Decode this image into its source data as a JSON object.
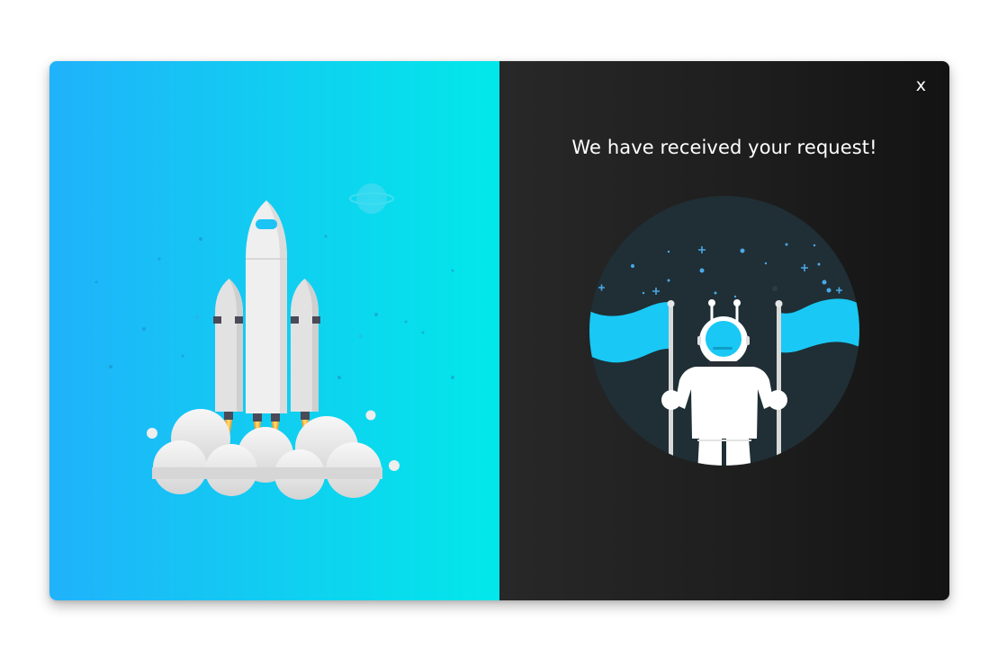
{
  "modal": {
    "close_label": "x",
    "heading": "We have received your request!"
  },
  "illustrations": {
    "left": "rocket-launch-illustration",
    "right": "astronaut-with-flags-illustration"
  },
  "colors": {
    "left_gradient_start": "#20b2fb",
    "left_gradient_end": "#02e8ea",
    "right_background": "#1e1e1e",
    "accent_cyan": "#19c3f5",
    "text": "#ffffff"
  }
}
